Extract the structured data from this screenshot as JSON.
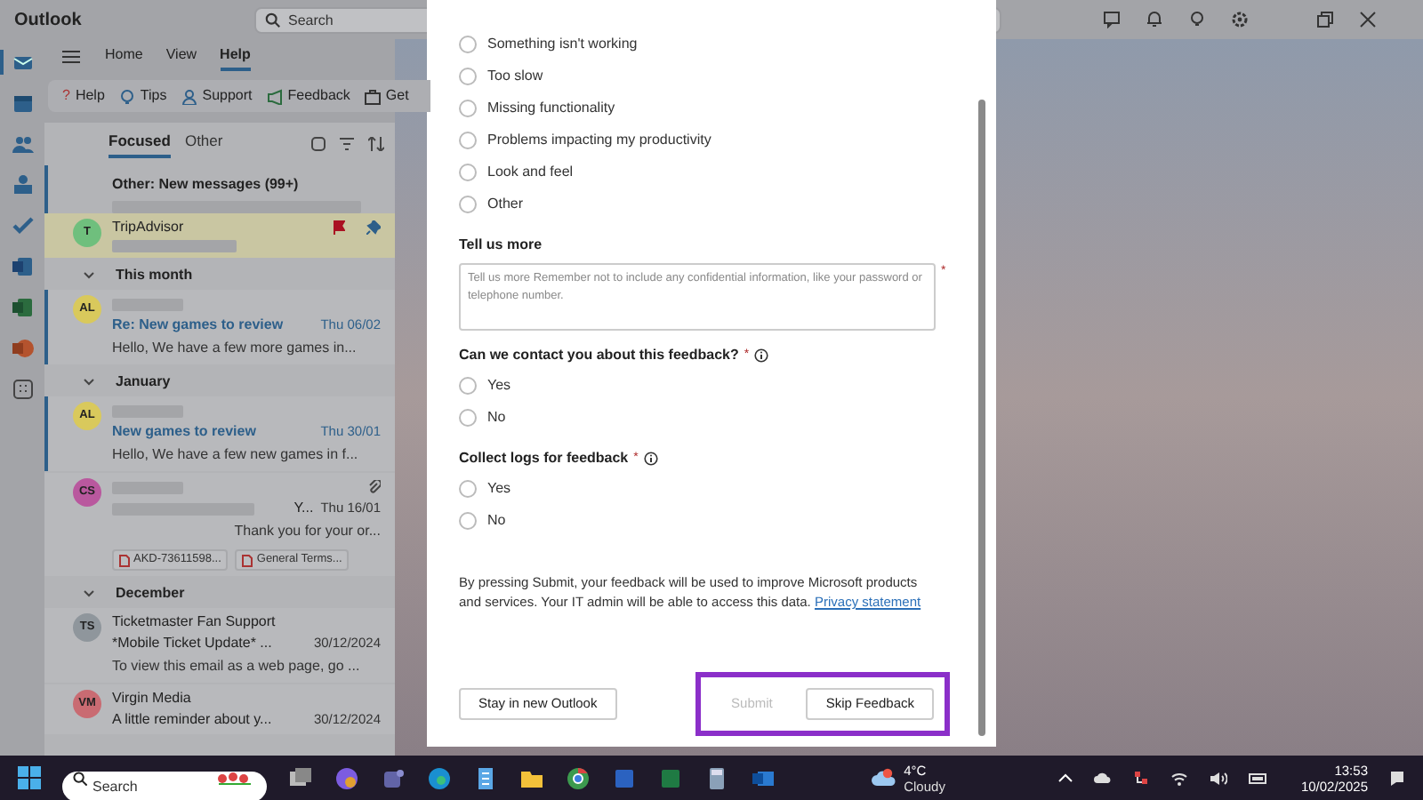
{
  "app": {
    "title": "Outlook",
    "search_placeholder": "Search"
  },
  "rail": [
    {
      "kind": "mail",
      "selected": true
    },
    {
      "kind": "calendar",
      "selected": false
    },
    {
      "kind": "people",
      "selected": false
    },
    {
      "kind": "groups",
      "selected": false
    },
    {
      "kind": "todo",
      "selected": false
    },
    {
      "kind": "word",
      "selected": false
    },
    {
      "kind": "excel",
      "selected": false
    },
    {
      "kind": "powerpoint",
      "selected": false
    },
    {
      "kind": "apps",
      "selected": false
    }
  ],
  "nav_tabs": [
    {
      "label": "Home",
      "selected": false
    },
    {
      "label": "View",
      "selected": false
    },
    {
      "label": "Help",
      "selected": true
    }
  ],
  "ribbon": [
    {
      "label": "Help",
      "kind": "help",
      "icon": "?"
    },
    {
      "label": "Tips",
      "kind": "tips"
    },
    {
      "label": "Support",
      "kind": "support"
    },
    {
      "label": "Feedback",
      "kind": "feedback"
    },
    {
      "label": "Get",
      "kind": "get"
    }
  ],
  "mail_tabs": [
    {
      "label": "Focused",
      "selected": true
    },
    {
      "label": "Other",
      "selected": false
    }
  ],
  "mail_list": [
    {
      "kind": "banner",
      "title": "Other: New messages (99+)"
    },
    {
      "kind": "message",
      "avatar": "T",
      "color": "#6fbf7d",
      "sender": "TripAdvisor",
      "flagged": true,
      "pinned": true,
      "unread": false,
      "highlighted": true
    },
    {
      "kind": "header",
      "title": "This month"
    },
    {
      "kind": "message",
      "avatar": "AL",
      "color": "#d9c95c",
      "subject": "Re: New games to review",
      "date": "Thu 06/02",
      "preview": "Hello, We have a few more games in...",
      "unread": true,
      "flagged": false,
      "pinned": false,
      "highlighted": false
    },
    {
      "kind": "header",
      "title": "January"
    },
    {
      "kind": "message",
      "avatar": "AL",
      "color": "#d9c95c",
      "subject": "New games to review",
      "date": "Thu 30/01",
      "preview": "Hello, We have a few new games in f...",
      "unread": true,
      "flagged": false,
      "pinned": false,
      "highlighted": false
    },
    {
      "kind": "message",
      "avatar": "CS",
      "color": "#b9589e",
      "subject": "Y...",
      "date": "Thu 16/01",
      "preview": "Thank you for your or...",
      "attachments": [
        "AKD-73611598...",
        "General Terms..."
      ],
      "unread": false,
      "flagged": false,
      "pinned": false,
      "highlighted": false
    },
    {
      "kind": "header",
      "title": "December"
    },
    {
      "kind": "message",
      "avatar": "TS",
      "color": "#8f969c",
      "sender": "Ticketmaster Fan Support",
      "subject": "*Mobile Ticket Update* ...",
      "date": "30/12/2024",
      "preview": "To view this email as a web page, go ...",
      "unread": false,
      "flagged": false,
      "pinned": false,
      "highlighted": false
    },
    {
      "kind": "message",
      "avatar": "VM",
      "color": "#c96b72",
      "sender": "Virgin Media",
      "subject": "A little reminder about y...",
      "date": "30/12/2024",
      "unread": false,
      "flagged": false,
      "pinned": false,
      "highlighted": false
    }
  ],
  "dialog": {
    "questions": [
      {
        "kind": "radio_group",
        "options": [
          {
            "label": "Something isn't working",
            "selected": false
          },
          {
            "label": "Too slow",
            "selected": false
          },
          {
            "label": "Missing functionality",
            "selected": false
          },
          {
            "label": "Problems impacting my productivity",
            "selected": false
          },
          {
            "label": "Look and feel",
            "selected": false
          },
          {
            "label": "Other",
            "selected": false
          }
        ]
      },
      {
        "kind": "textarea",
        "title": "Tell us more",
        "placeholder": "Tell us more Remember not to include any confidential information, like your password or telephone number.",
        "required": true,
        "required_mark": "*"
      },
      {
        "kind": "radio_group",
        "title": "Can we contact you about this feedback?",
        "required": true,
        "required_mark": "*",
        "info": true,
        "options": [
          {
            "label": "Yes",
            "selected": false
          },
          {
            "label": "No",
            "selected": false
          }
        ]
      },
      {
        "kind": "radio_group",
        "title": "Collect logs for feedback",
        "required": true,
        "required_mark": "*",
        "info": true,
        "options": [
          {
            "label": "Yes",
            "selected": false
          },
          {
            "label": "No",
            "selected": false
          }
        ]
      }
    ],
    "notice": "By pressing Submit, your feedback will be used to improve Microsoft products and services. Your IT admin will be able to access this data.",
    "notice_link": "Privacy statement",
    "buttons": [
      {
        "label": "Stay in new Outlook",
        "disabled": false
      },
      {
        "label": "Submit",
        "disabled": true
      },
      {
        "label": "Skip Feedback",
        "disabled": false
      }
    ],
    "highlight": true
  },
  "taskbar": {
    "search_placeholder": "Search",
    "weather": {
      "temp": "4°C",
      "condition": "Cloudy"
    },
    "clock": {
      "time": "13:53",
      "date": "10/02/2025"
    }
  }
}
